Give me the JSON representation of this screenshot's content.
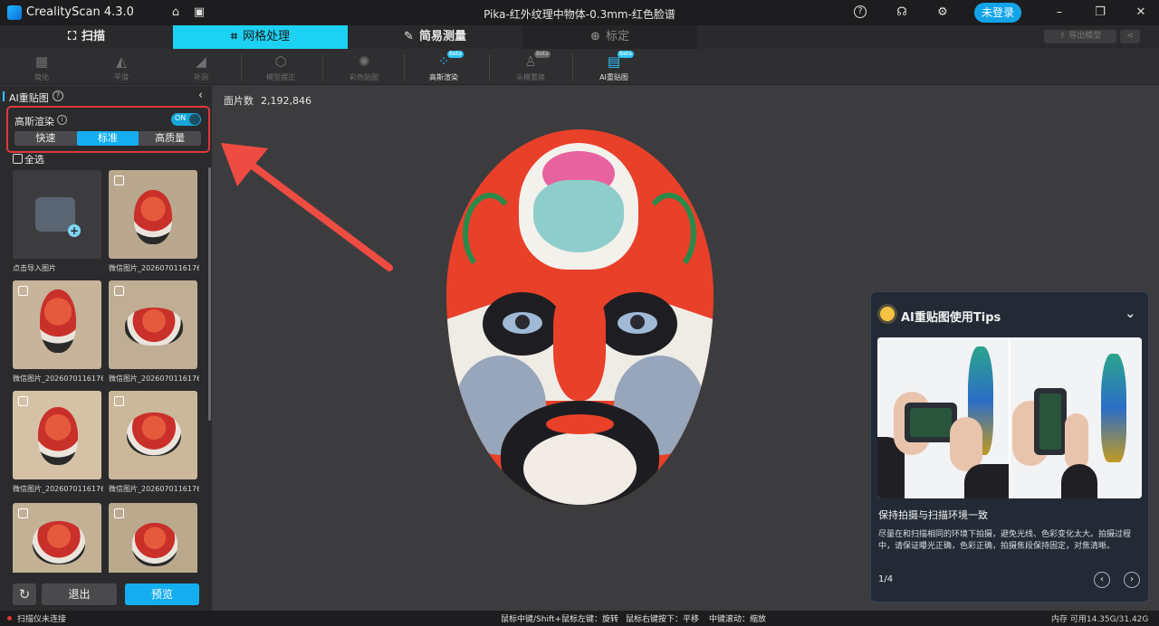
{
  "titlebar": {
    "app_name": "CrealityScan 4.3.0",
    "doc_title": "Pika-红外纹理中物体-0.3mm-红色脸谱",
    "login_label": "未登录",
    "icons": [
      "home-icon",
      "folder-icon",
      "help-icon",
      "support-icon",
      "settings-icon",
      "minimize-icon",
      "restore-icon",
      "close-icon"
    ]
  },
  "modetabs": [
    {
      "label": "扫描",
      "icon": "scan-icon",
      "state": "normal"
    },
    {
      "label": "网格处理",
      "icon": "mesh-icon",
      "state": "active"
    },
    {
      "label": "简易测量",
      "icon": "ruler-icon",
      "state": "normal"
    },
    {
      "label": "标定",
      "icon": "target-icon",
      "state": "disabled"
    }
  ],
  "right_mini": {
    "export_label": "导出模型"
  },
  "toolbar": {
    "tools": [
      {
        "label": "简化",
        "icon": "simplify-icon",
        "enabled": false,
        "beta": false
      },
      {
        "label": "平滑",
        "icon": "smooth-icon",
        "enabled": false,
        "beta": false
      },
      {
        "label": "补洞",
        "icon": "fill-hole-icon",
        "enabled": false,
        "beta": false
      },
      {
        "label": "模型摆正",
        "icon": "align-model-icon",
        "enabled": false,
        "beta": false
      },
      {
        "label": "彩色贴图",
        "icon": "palette-icon",
        "enabled": false,
        "beta": false
      },
      {
        "label": "高斯渲染",
        "icon": "gaussian-icon",
        "enabled": true,
        "beta": true
      },
      {
        "label": "头模置换",
        "icon": "head-swap-icon",
        "enabled": false,
        "beta": true
      },
      {
        "label": "AI重贴图",
        "icon": "ai-retexture-icon",
        "enabled": true,
        "beta": true
      }
    ],
    "beta_label": "Beta"
  },
  "panel": {
    "title": "AI重贴图",
    "gaussian_label": "高斯渲染",
    "toggle_label": "ON",
    "quality_options": [
      "快速",
      "标准",
      "高质量"
    ],
    "quality_selected": "标准",
    "select_all_label": "全选",
    "import_label": "点击导入图片",
    "images": [
      "微信图片_2026070116176...",
      "微信图片_2026070116176...",
      "微信图片_2026070116176...",
      "微信图片_2026070116176...",
      "微信图片_2026070116176...",
      "",
      ""
    ],
    "exit_label": "退出",
    "preview_label": "预览"
  },
  "viewport": {
    "face_count_label": "面片数",
    "face_count_value": "2,192,846"
  },
  "tips": {
    "title": "AI重贴图使用Tips",
    "subtitle": "保持拍摄与扫描环境一致",
    "body": "尽量在和扫描相同的环境下拍摄，避免光线、色彩变化太大。拍摄过程中，请保证曝光正确，色彩正确，拍摄焦段保持固定，对焦清晰。",
    "page": "1/4"
  },
  "statusbar": {
    "scanner_status": "扫描仪未连接",
    "hint_rotate": "鼠标中键/Shift+鼠标左键：旋转",
    "hint_pan": "鼠标右键按下：平移",
    "hint_zoom": "中键滚动：缩放",
    "memory": "内存 可用14.35G/31.42G"
  },
  "colors": {
    "accent": "#14aef0",
    "tab_active": "#1dd1f3",
    "highlight_red": "#e0373b"
  }
}
